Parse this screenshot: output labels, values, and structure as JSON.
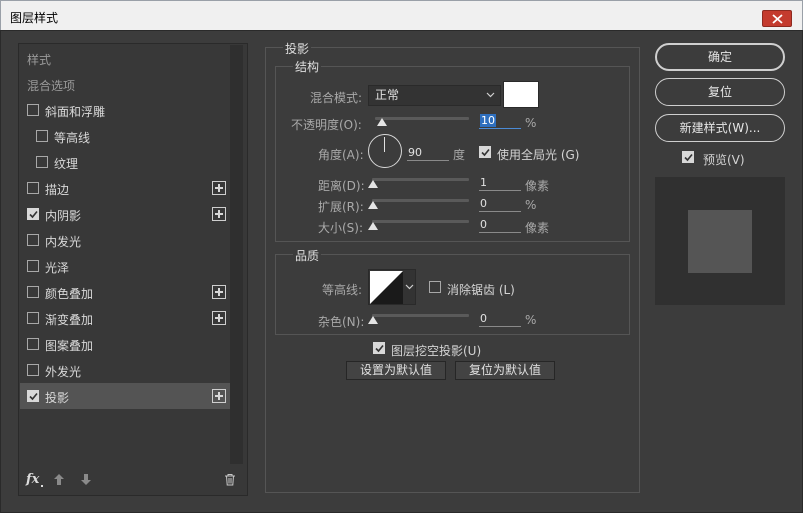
{
  "window": {
    "title": "图层样式"
  },
  "sidebar": {
    "items": [
      {
        "label": "样式",
        "checkbox": null,
        "plus": false,
        "selected": false,
        "header": true
      },
      {
        "label": "混合选项",
        "checkbox": null,
        "plus": false,
        "selected": false,
        "header": true
      },
      {
        "label": "斜面和浮雕",
        "checkbox": false,
        "plus": false,
        "selected": false
      },
      {
        "label": "等高线",
        "checkbox": false,
        "plus": false,
        "selected": false,
        "indent": true
      },
      {
        "label": "纹理",
        "checkbox": false,
        "plus": false,
        "selected": false,
        "indent": true
      },
      {
        "label": "描边",
        "checkbox": false,
        "plus": true,
        "selected": false
      },
      {
        "label": "内阴影",
        "checkbox": true,
        "plus": true,
        "selected": false
      },
      {
        "label": "内发光",
        "checkbox": false,
        "plus": false,
        "selected": false
      },
      {
        "label": "光泽",
        "checkbox": false,
        "plus": false,
        "selected": false
      },
      {
        "label": "颜色叠加",
        "checkbox": false,
        "plus": true,
        "selected": false
      },
      {
        "label": "渐变叠加",
        "checkbox": false,
        "plus": true,
        "selected": false
      },
      {
        "label": "图案叠加",
        "checkbox": false,
        "plus": false,
        "selected": false
      },
      {
        "label": "外发光",
        "checkbox": false,
        "plus": false,
        "selected": false
      },
      {
        "label": "投影",
        "checkbox": true,
        "plus": true,
        "selected": true
      }
    ],
    "fx_label": "fx"
  },
  "drop_shadow": {
    "section_title": "投影",
    "structure": {
      "title": "结构",
      "blend_mode_label": "混合模式:",
      "blend_mode_value": "正常",
      "color_swatch": "#ffffff",
      "opacity_label": "不透明度(O):",
      "opacity_value": "10",
      "opacity_unit": "%",
      "angle_label": "角度(A):",
      "angle_value": "90",
      "angle_unit": "度",
      "global_light_label": "使用全局光 (G)",
      "global_light_checked": true,
      "distance_label": "距离(D):",
      "distance_value": "1",
      "distance_unit": "像素",
      "spread_label": "扩展(R):",
      "spread_value": "0",
      "spread_unit": "%",
      "size_label": "大小(S):",
      "size_value": "0",
      "size_unit": "像素"
    },
    "quality": {
      "title": "品质",
      "contour_label": "等高线:",
      "antialias_label": "消除锯齿 (L)",
      "antialias_checked": false,
      "noise_label": "杂色(N):",
      "noise_value": "0",
      "noise_unit": "%"
    },
    "knockout_label": "图层挖空投影(U)",
    "knockout_checked": true,
    "make_default_label": "设置为默认值",
    "reset_default_label": "复位为默认值"
  },
  "actions": {
    "ok_label": "确定",
    "reset_label": "复位",
    "new_style_label": "新建样式(W)...",
    "preview_label": "预览(V)",
    "preview_checked": true
  },
  "colors": {
    "accent_focus": "#4b8bd6",
    "close_button": "#c43b2e",
    "dialog_bg": "#3c3c3c"
  }
}
